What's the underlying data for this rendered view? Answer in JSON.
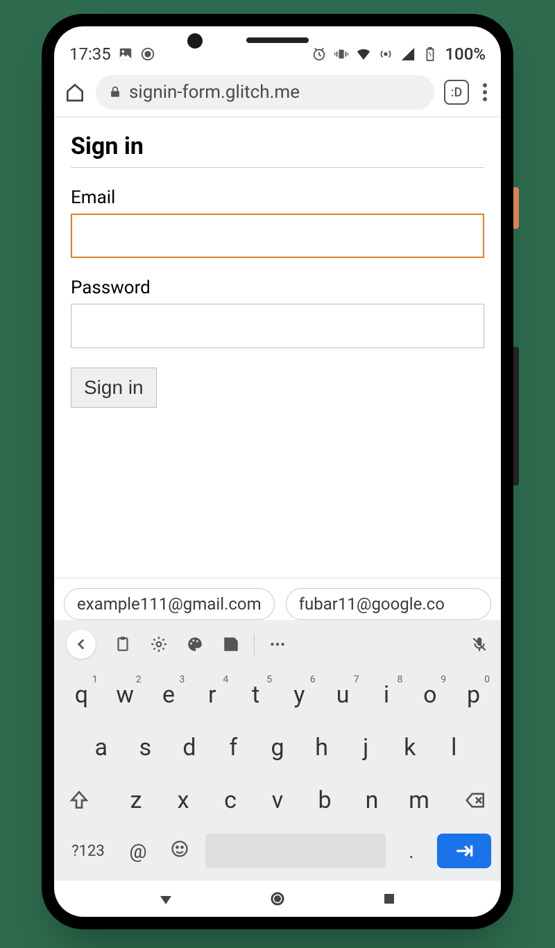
{
  "status": {
    "time": "17:35",
    "battery": "100%"
  },
  "browser": {
    "url": "signin-form.glitch.me",
    "tab_badge": ":D"
  },
  "page": {
    "heading": "Sign in",
    "email_label": "Email",
    "email_value": "",
    "password_label": "Password",
    "password_value": "",
    "submit_label": "Sign in"
  },
  "suggestions": [
    "example111@gmail.com",
    "fubar11@google.co"
  ],
  "keyboard": {
    "row1": [
      "q",
      "w",
      "e",
      "r",
      "t",
      "y",
      "u",
      "i",
      "o",
      "p"
    ],
    "row1_nums": [
      "1",
      "2",
      "3",
      "4",
      "5",
      "6",
      "7",
      "8",
      "9",
      "0"
    ],
    "row2": [
      "a",
      "s",
      "d",
      "f",
      "g",
      "h",
      "j",
      "k",
      "l"
    ],
    "row3": [
      "z",
      "x",
      "c",
      "v",
      "b",
      "n",
      "m"
    ],
    "mode": "?123",
    "at": "@",
    "period": "."
  }
}
